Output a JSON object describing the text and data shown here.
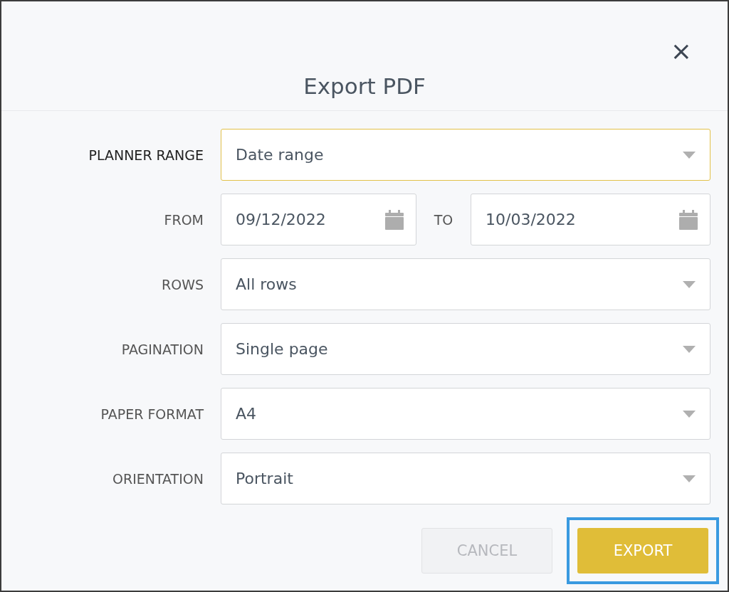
{
  "dialog": {
    "title": "Export PDF",
    "close": "×"
  },
  "rows": [
    {
      "kind": "select",
      "label": "PLANNER RANGE",
      "value": "Date range",
      "focused": true
    },
    {
      "kind": "daterange",
      "label": "FROM",
      "value": "09/12/2022",
      "to_label": "TO",
      "to_value": "10/03/2022",
      "focused": false
    },
    {
      "kind": "select",
      "label": "ROWS",
      "value": "All rows",
      "focused": false
    },
    {
      "kind": "select",
      "label": "PAGINATION",
      "value": "Single page",
      "focused": false
    },
    {
      "kind": "select",
      "label": "PAPER FORMAT",
      "value": "A4",
      "focused": false
    },
    {
      "kind": "select",
      "label": "ORIENTATION",
      "value": "Portrait",
      "focused": false
    }
  ],
  "buttons": [
    {
      "label": "CANCEL",
      "kind": "secondary",
      "disabled": true,
      "highlighted": false
    },
    {
      "label": "EXPORT",
      "kind": "primary",
      "disabled": false,
      "highlighted": true
    }
  ]
}
